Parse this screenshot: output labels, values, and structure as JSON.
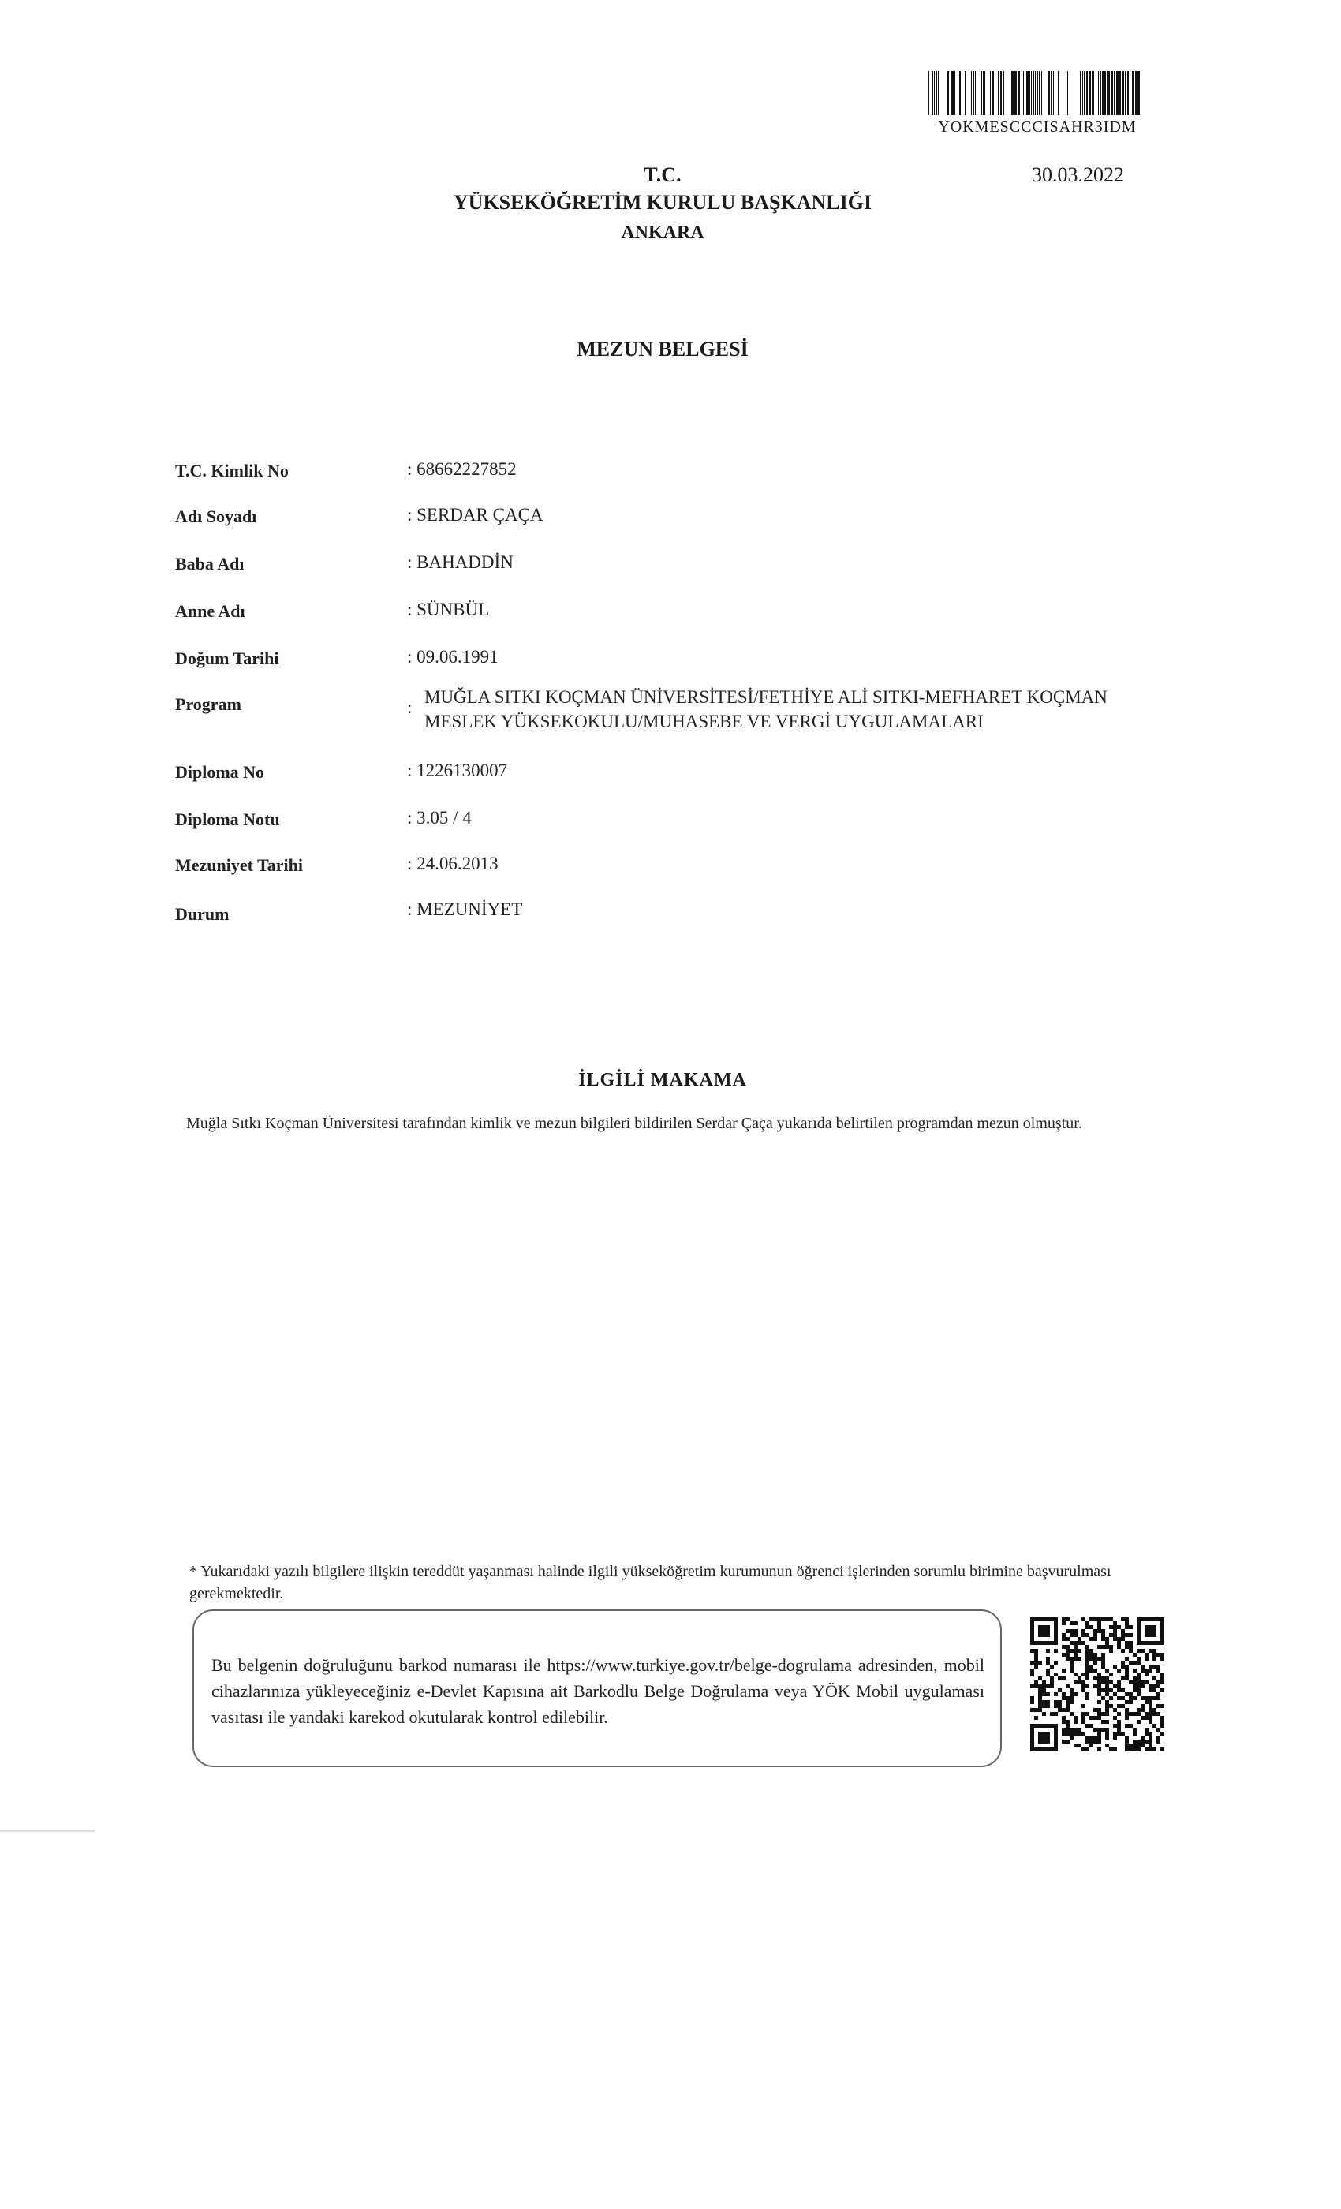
{
  "header": {
    "barcode_text": "YOKMESCCCISAHR3IDM",
    "date": "30.03.2022",
    "line1": "T.C.",
    "line2": "YÜKSEKÖĞRETİM KURULU BAŞKANLIĞI",
    "line3": "ANKARA"
  },
  "title": "MEZUN BELGESİ",
  "fields": [
    {
      "label": "T.C. Kimlik No",
      "value": ": 68662227852"
    },
    {
      "label": "Adı Soyadı",
      "value": ": SERDAR ÇAÇA"
    },
    {
      "label": "Baba Adı",
      "value": ": BAHADDİN"
    },
    {
      "label": "Anne Adı",
      "value": ": SÜNBÜL"
    },
    {
      "label": "Doğum Tarihi",
      "value": ": 09.06.1991"
    },
    {
      "label": "Program",
      "value": ":",
      "value_line1": "MUĞLA SITKI KOÇMAN ÜNİVERSİTESİ/FETHİYE ALİ SITKI-MEFHARET KOÇMAN",
      "value_line2": "MESLEK YÜKSEKOKULU/MUHASEBE VE VERGİ UYGULAMALARI"
    },
    {
      "label": "Diploma No",
      "value": ": 1226130007"
    },
    {
      "label": "Diploma Notu",
      "value": ": 3.05 / 4"
    },
    {
      "label": "Mezuniyet Tarihi",
      "value": ": 24.06.2013"
    },
    {
      "label": "Durum",
      "value": ": MEZUNİYET"
    }
  ],
  "section": {
    "title": "İLGİLİ MAKAMA",
    "body": "Muğla Sıtkı Koçman Üniversitesi tarafından kimlik ve mezun bilgileri bildirilen Serdar Çaça yukarıda belirtilen programdan mezun olmuştur."
  },
  "footnote": "* Yukarıdaki yazılı bilgilere ilişkin tereddüt yaşanması halinde ilgili yükseköğretim kurumunun öğrenci işlerinden sorumlu birimine başvurulması gerekmektedir.",
  "verification": {
    "text": "Bu belgenin doğruluğunu barkod numarası ile https://www.turkiye.gov.tr/belge-dogrulama adresinden, mobil cihazlarınıza yükleyeceğiniz e-Devlet Kapısına ait Barkodlu Belge Doğrulama veya YÖK Mobil uygulaması vasıtası ile yandaki karekod okutularak kontrol edilebilir."
  }
}
